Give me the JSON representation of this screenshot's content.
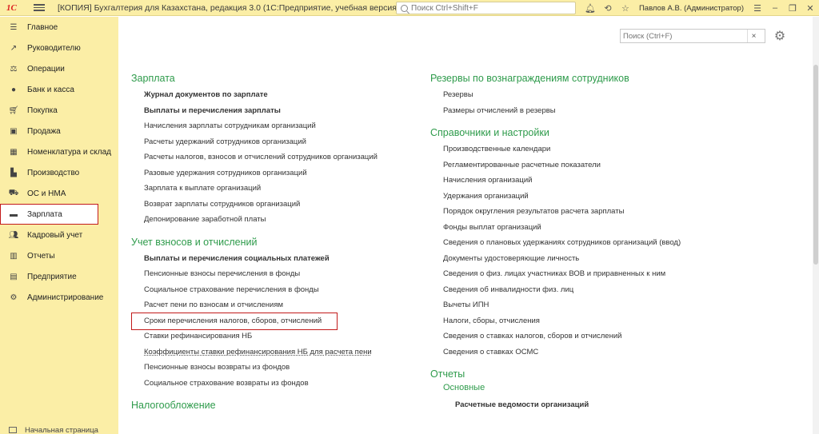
{
  "titlebar": {
    "logo": "1С",
    "title": "[КОПИЯ] Бухгалтерия для Казахстана, редакция 3.0  (1С:Предприятие, учебная версия)",
    "search_placeholder": "Поиск Ctrl+Shift+F",
    "user": "Павлов А.В. (Администратор)"
  },
  "sidebar": {
    "items": [
      {
        "label": "Главное",
        "icon": "menu-icon"
      },
      {
        "label": "Руководителю",
        "icon": "chart-icon"
      },
      {
        "label": "Операции",
        "icon": "operations-icon"
      },
      {
        "label": "Банк и касса",
        "icon": "bank-icon"
      },
      {
        "label": "Покупка",
        "icon": "purchase-icon"
      },
      {
        "label": "Продажа",
        "icon": "sale-icon"
      },
      {
        "label": "Номенклатура и склад",
        "icon": "warehouse-icon"
      },
      {
        "label": "Производство",
        "icon": "production-icon"
      },
      {
        "label": "ОС и НМА",
        "icon": "assets-icon"
      },
      {
        "label": "Зарплата",
        "icon": "salary-icon",
        "active": true
      },
      {
        "label": "Кадровый учет",
        "icon": "hr-icon"
      },
      {
        "label": "Отчеты",
        "icon": "reports-icon"
      },
      {
        "label": "Предприятие",
        "icon": "enterprise-icon"
      },
      {
        "label": "Администрирование",
        "icon": "admin-icon"
      }
    ],
    "bottom": "Начальная страница"
  },
  "main": {
    "search_placeholder": "Поиск (Ctrl+F)",
    "left": {
      "salary": {
        "title": "Зарплата",
        "links": [
          "Журнал документов по зарплате",
          "Выплаты и перечисления зарплаты",
          "Начисления зарплаты сотрудникам организаций",
          "Расчеты удержаний сотрудников организаций",
          "Расчеты налогов, взносов и отчислений сотрудников организаций",
          "Разовые удержания сотрудников организаций",
          "Зарплата к выплате организаций",
          "Возврат зарплаты сотрудников организаций",
          "Депонирование заработной платы"
        ]
      },
      "contrib": {
        "title": "Учет взносов и отчислений",
        "links": [
          "Выплаты и перечисления социальных платежей",
          "Пенсионные взносы перечисления в фонды",
          "Социальное страхование перечисления в фонды",
          "Расчет пени по взносам и отчислениям",
          "Сроки перечисления налогов, сборов, отчислений",
          "Ставки рефинансирования НБ",
          "Коэффициенты ставки рефинансирования НБ для расчета пени",
          "Пенсионные взносы возвраты из фондов",
          "Социальное страхование возвраты из фондов"
        ]
      },
      "tax": {
        "title": "Налогообложение"
      }
    },
    "right": {
      "reserves": {
        "title": "Резервы по вознаграждениям сотрудников",
        "links": [
          "Резервы",
          "Размеры отчислений в резервы"
        ]
      },
      "refs": {
        "title": "Справочники и настройки",
        "links": [
          "Производственные календари",
          "Регламентированные расчетные показатели",
          "Начисления организаций",
          "Удержания организаций",
          "Порядок округления результатов расчета зарплаты",
          "Фонды выплат организаций",
          "Сведения о плановых удержаниях сотрудников организаций (ввод)",
          "Документы удостоверяющие личность",
          "Сведения о физ. лицах участниках ВОВ и приравненных к ним",
          "Сведения об инвалидности физ. лиц",
          "Вычеты ИПН",
          "Налоги, сборы, отчисления",
          "Сведения о ставках налогов, сборов и отчислений",
          "Сведения о ставках ОСМС"
        ]
      },
      "reports": {
        "title": "Отчеты",
        "subtitle": "Основные",
        "links": [
          "Расчетные ведомости организаций"
        ]
      }
    }
  }
}
